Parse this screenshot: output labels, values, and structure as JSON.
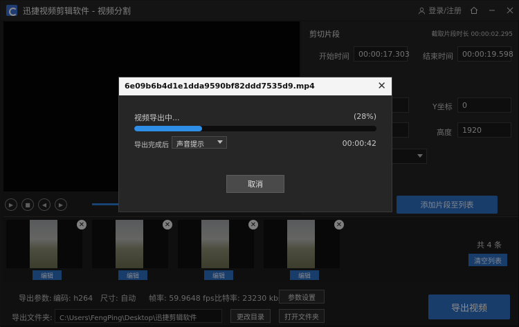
{
  "titlebar": {
    "app_name": "迅捷视频剪辑软件",
    "separator": "-",
    "module": "视频分割",
    "login": "登录/注册",
    "icons": [
      "user-icon",
      "home-icon",
      "minimize-icon",
      "close-icon"
    ]
  },
  "panel": {
    "title": "剪切片段",
    "clip_duration_label": "截取片段时长",
    "clip_duration": "00:00:02.295",
    "start_label": "开始时间",
    "start_value": "00:00:17.303",
    "end_label": "结束时间",
    "end_value": "00:00:19.598",
    "y_label": "Y坐标",
    "y_value": "0",
    "height_label": "高度",
    "height_value": "1920",
    "add_button": "添加片段至列表"
  },
  "clips": {
    "edit_label": "编辑",
    "count": "共 4 条",
    "clear_button": "清空列表"
  },
  "export": {
    "params_label": "导出参数:",
    "codec": "编码: h264",
    "size": "尺寸: 自动",
    "fps": "帧率: 59.9648 fps",
    "bitrate": "比特率: 23230 kbs",
    "settings_button": "参数设置",
    "folder_label": "导出文件夹:",
    "folder_path": "C:\\Users\\FengPing\\Desktop\\迅捷剪辑软件",
    "change_dir_button": "更改目录",
    "open_folder_button": "打开文件夹",
    "export_button": "导出视频"
  },
  "dialog": {
    "filename": "6e09b6b4d1e1dda9590bf82ddd7535d9.mp4",
    "status": "视频导出中...",
    "percent_text": "(28%)",
    "progress": 0.28,
    "after_label": "导出完成后",
    "after_option": "声音提示",
    "elapsed": "00:00:42",
    "cancel_button": "取消"
  },
  "colors": {
    "accent": "#2d6fc4",
    "progress": "#2f8fe6"
  }
}
